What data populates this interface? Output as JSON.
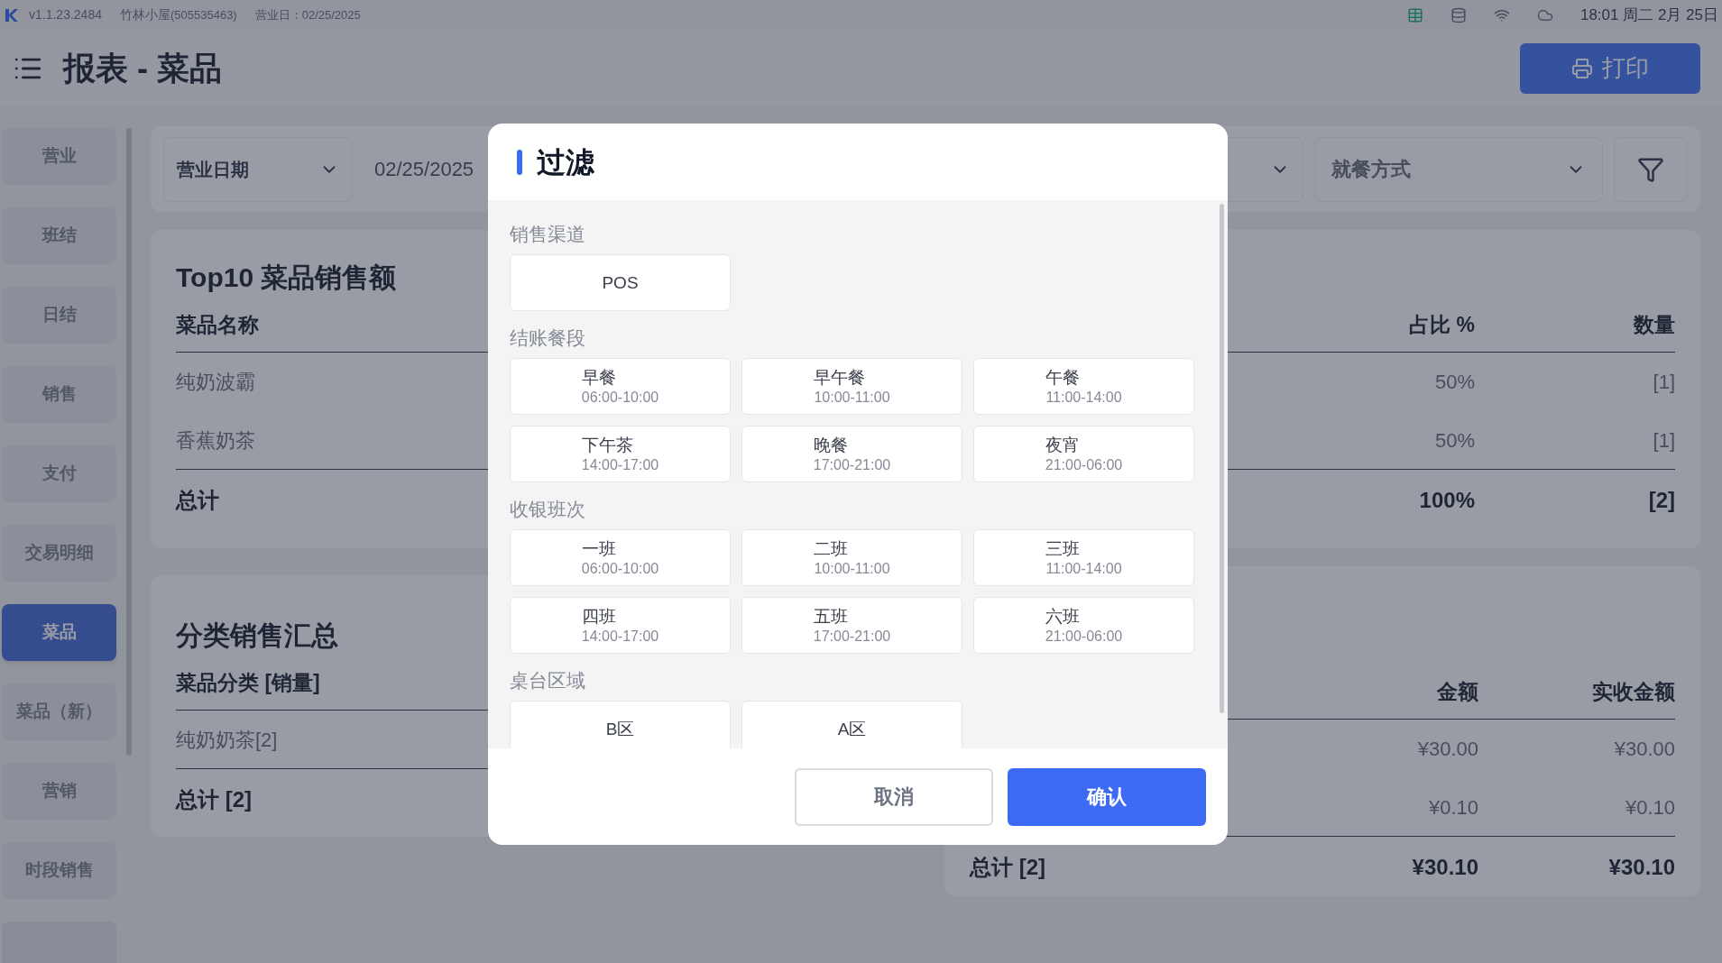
{
  "status_bar": {
    "version": "v1.1.23.2484",
    "shop": "竹林小屋",
    "shop_id": "(505535463)",
    "business_day": "营业日：02/25/2025",
    "time": "18:01 周二 2月 25日"
  },
  "header": {
    "title": "报表 - 菜品",
    "print_button": "打印"
  },
  "sidebar": {
    "items": [
      {
        "label": "营业",
        "selected": false
      },
      {
        "label": "班结",
        "selected": false
      },
      {
        "label": "日结",
        "selected": false
      },
      {
        "label": "销售",
        "selected": false
      },
      {
        "label": "支付",
        "selected": false
      },
      {
        "label": "交易明细",
        "selected": false
      },
      {
        "label": "菜品",
        "selected": true
      },
      {
        "label": "菜品（新）",
        "selected": false
      },
      {
        "label": "营销",
        "selected": false
      },
      {
        "label": "时段销售",
        "selected": false
      }
    ]
  },
  "filter_bar": {
    "date_type": "营业日期",
    "date": "02/25/2025",
    "dining_mode": "就餐方式"
  },
  "top10": {
    "title": "Top10 菜品销售额",
    "columns": [
      "菜品名称",
      "占比 %",
      "数量"
    ],
    "rows": [
      [
        "纯奶波霸",
        "50%",
        "[1]"
      ],
      [
        "香蕉奶茶",
        "50%",
        "[1]"
      ]
    ],
    "total": [
      "总计",
      "100%",
      "[2]"
    ]
  },
  "category": {
    "title": "分类销售汇总",
    "column": "菜品分类 [销量]",
    "rows": [
      "纯奶奶茶[2]"
    ],
    "total": "总计 [2]"
  },
  "amounts": {
    "columns": [
      "金额",
      "实收金额"
    ],
    "rows": [
      [
        "¥30.00",
        "¥30.00"
      ],
      [
        "¥0.10",
        "¥0.10"
      ]
    ],
    "total": [
      "总计 [2]",
      "¥30.10",
      "¥30.10"
    ]
  },
  "dialog": {
    "title": "过滤",
    "sections": [
      {
        "label": "销售渠道",
        "options": [
          {
            "name": "POS",
            "selected": false
          }
        ]
      },
      {
        "label": "结账餐段",
        "options": [
          {
            "name": "早餐",
            "time": "06:00-10:00",
            "selected": false
          },
          {
            "name": "早午餐",
            "time": "10:00-11:00",
            "selected": false
          },
          {
            "name": "午餐",
            "time": "11:00-14:00",
            "selected": false
          },
          {
            "name": "下午茶",
            "time": "14:00-17:00",
            "selected": false
          },
          {
            "name": "晚餐",
            "time": "17:00-21:00",
            "selected": false
          },
          {
            "name": "夜宵",
            "time": "21:00-06:00",
            "selected": false
          }
        ]
      },
      {
        "label": "收银班次",
        "options": [
          {
            "name": "一班",
            "time": "06:00-10:00",
            "selected": false
          },
          {
            "name": "二班",
            "time": "10:00-11:00",
            "selected": false
          },
          {
            "name": "三班",
            "time": "11:00-14:00",
            "selected": false
          },
          {
            "name": "四班",
            "time": "14:00-17:00",
            "selected": false
          },
          {
            "name": "五班",
            "time": "17:00-21:00",
            "selected": false
          },
          {
            "name": "六班",
            "time": "21:00-06:00",
            "selected": false
          }
        ]
      },
      {
        "label": "桌台区域",
        "options": [
          {
            "name": "B区",
            "selected": false
          },
          {
            "name": "A区",
            "selected": false
          }
        ]
      }
    ],
    "cancel": "取消",
    "confirm": "确认"
  }
}
